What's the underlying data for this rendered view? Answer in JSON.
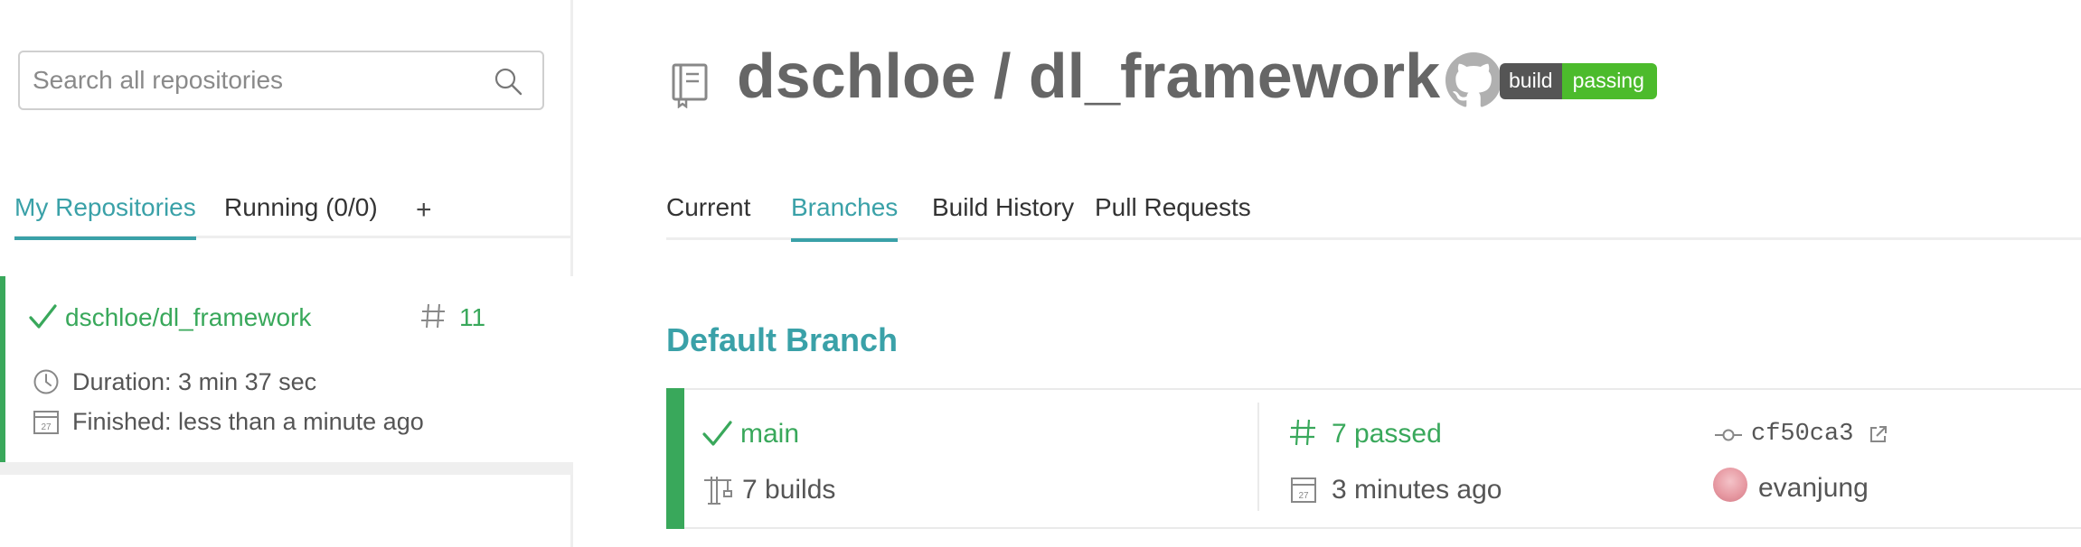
{
  "sidebar": {
    "search": {
      "placeholder": "Search all repositories",
      "value": ""
    },
    "tabs": [
      {
        "label": "My Repositories",
        "active": true
      },
      {
        "label": "Running (0/0)",
        "active": false
      },
      {
        "label": "+",
        "active": false
      }
    ],
    "repo_card": {
      "name": "dschloe/dl_framework",
      "build_number": "11",
      "duration": "Duration: 3 min 37 sec",
      "finished": "Finished: less than a minute ago",
      "status": "passed",
      "status_color": "#39a85b"
    }
  },
  "header": {
    "repo_title": "dschloe / dl_framework",
    "badge": {
      "left": "build",
      "right": "passing",
      "left_color": "#555555",
      "right_color": "#4cbb2c"
    }
  },
  "main": {
    "tabs": [
      {
        "label": "Current",
        "active": false
      },
      {
        "label": "Branches",
        "active": true
      },
      {
        "label": "Build History",
        "active": false
      },
      {
        "label": "Pull Requests",
        "active": false
      }
    ],
    "section_heading": "Default Branch",
    "default_branch": {
      "name": "main",
      "builds": "7 builds",
      "passed": "7 passed",
      "time": "3 minutes ago",
      "commit": "cf50ca3",
      "user": "evanjung"
    }
  },
  "colors": {
    "accent": "#3aa1a8",
    "success": "#39a85b"
  },
  "icons": {
    "search": "search-icon",
    "repo": "repo-book-icon",
    "github": "github-icon",
    "check": "check-icon",
    "hash": "hash-icon",
    "clock": "clock-icon",
    "calendar": "calendar-icon",
    "crane": "crane-icon",
    "commit": "commit-icon",
    "external": "external-link-icon"
  }
}
